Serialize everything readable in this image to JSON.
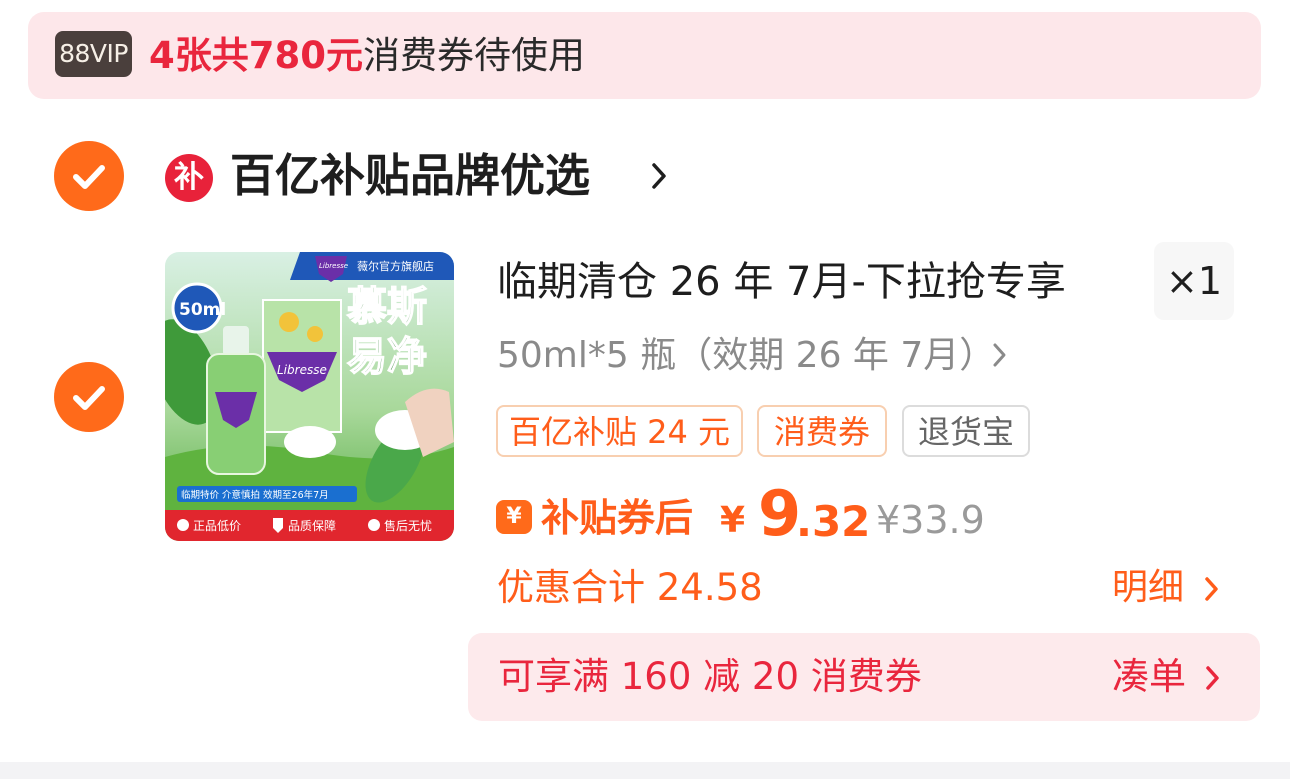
{
  "vip_banner": {
    "badge": "88VIP",
    "count": "4",
    "text_mid": "张共",
    "amount": "780",
    "unit": "元",
    "text_tail": "消费券待使用"
  },
  "shop": {
    "icon_char": "补",
    "name": "百亿补贴品牌优选"
  },
  "product": {
    "image_logo_text": "Libresse",
    "image_store_text": "薇尔官方旗舰店",
    "image_headline_1": "慕斯",
    "image_headline_2": "易净",
    "image_volume": "50ml",
    "image_bottom_1": "正品低价",
    "image_bottom_2": "品质保障",
    "image_bottom_3": "售后无忧",
    "image_notice": "临期特价 介意慎拍 效期至26年7月",
    "title": "临期清仓 26 年 7月-下拉抢专享",
    "quantity": "×1",
    "spec": "50ml*5 瓶（效期 26 年 7月）",
    "tags": [
      "百亿补贴 24 元",
      "消费券",
      "退货宝"
    ],
    "coupon_icon": "¥",
    "after_label": "补贴券后",
    "price_symbol": "¥",
    "price_int": "9",
    "price_dec": ".32",
    "original_price": "¥33.9",
    "discount_text": "优惠合计 24.58",
    "detail_label": "明细"
  },
  "coupon_bar": {
    "text": "可享满 160 减 20 消费券",
    "link": "凑单"
  },
  "colors": {
    "accent_orange": "#ff6a1a",
    "accent_red": "#e9263d",
    "banner_bg": "#fde7ea"
  }
}
